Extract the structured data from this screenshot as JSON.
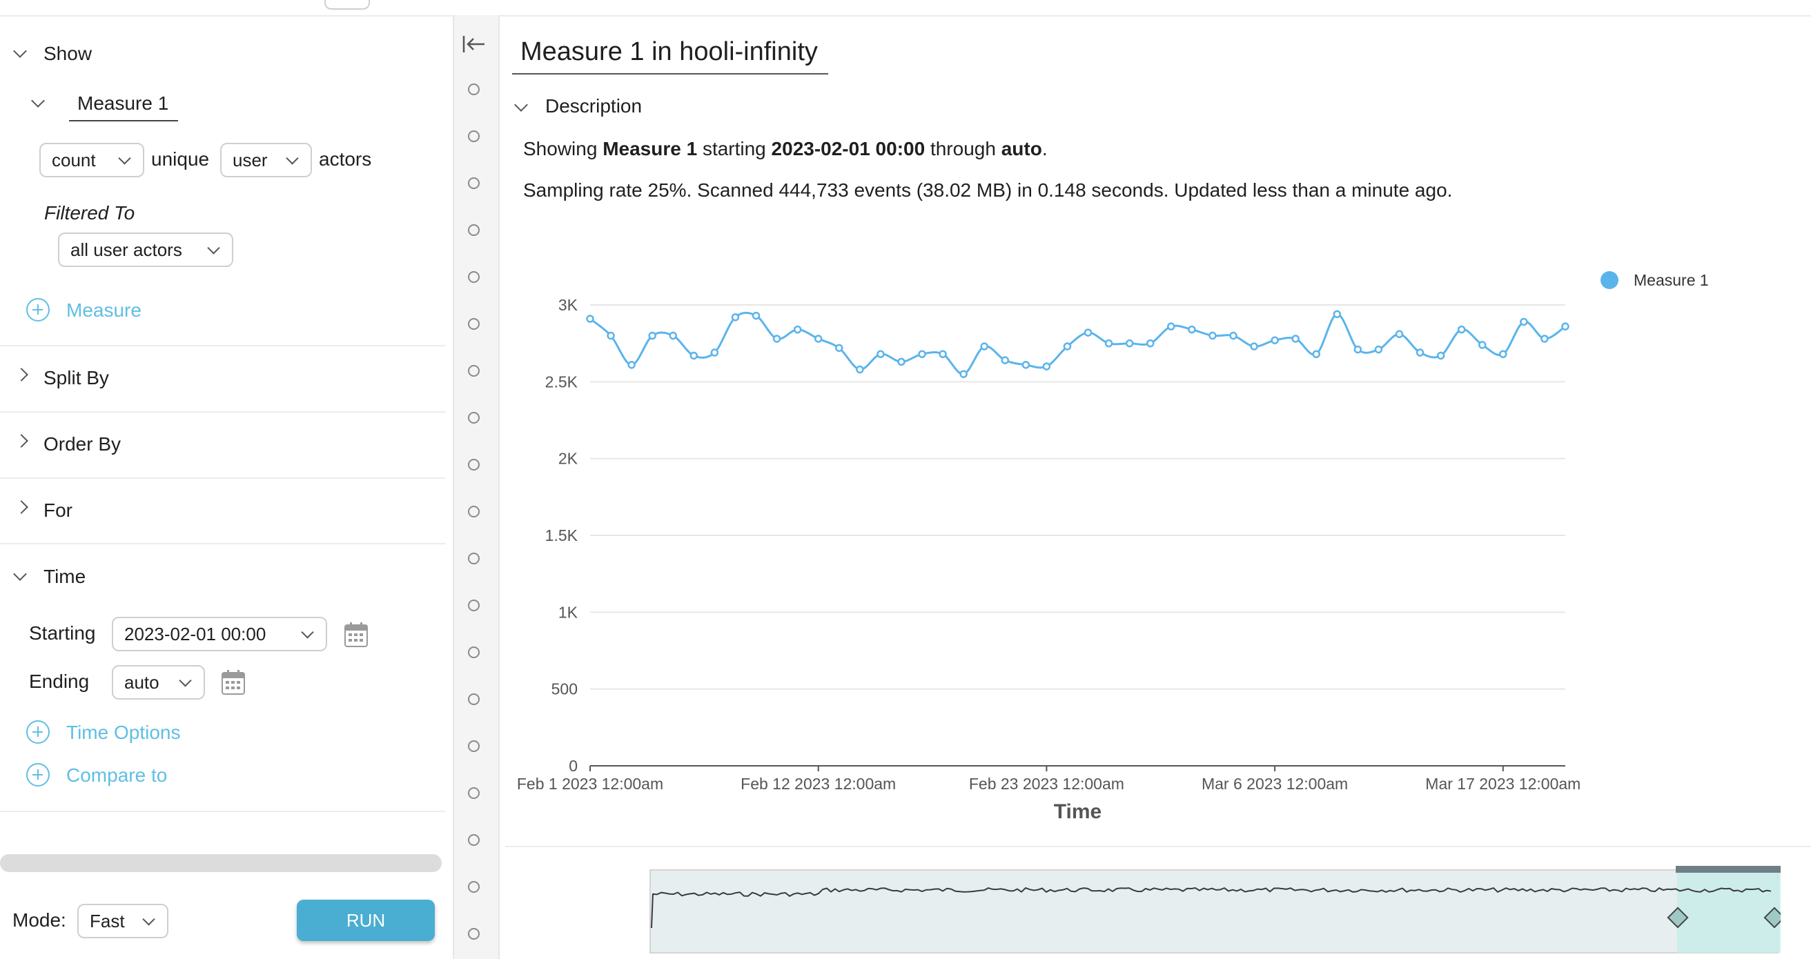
{
  "sidebar": {
    "show_label": "Show",
    "measure_tab": "Measure 1",
    "agg_select": "count",
    "unique_text": "unique",
    "entity_select": "user",
    "actors_text": "actors",
    "filtered_to_label": "Filtered To",
    "filter_select": "all user actors",
    "add_measure_label": "Measure",
    "split_by_label": "Split By",
    "order_by_label": "Order By",
    "for_label": "For",
    "time_label": "Time",
    "starting_label": "Starting",
    "starting_value": "2023-02-01 00:00",
    "ending_label": "Ending",
    "ending_value": "auto",
    "time_options_label": "Time Options",
    "compare_to_label": "Compare to",
    "mode_label": "Mode:",
    "mode_value": "Fast",
    "run_label": "RUN"
  },
  "main": {
    "title": "Measure 1 in hooli-infinity",
    "description_label": "Description",
    "summary": {
      "showing": "Showing",
      "measure": "Measure 1",
      "starting": "starting",
      "start_value": "2023-02-01 00:00",
      "through": "through",
      "end_value": "auto",
      "period": "."
    },
    "stats_line": "Sampling rate 25%. Scanned 444,733 events (38.02 MB) in 0.148 seconds. Updated less than a minute ago."
  },
  "colors": {
    "series": "#5ab4ec",
    "accent": "#5fbfe3",
    "run_button": "#49aed2",
    "brush": "#c8ece9",
    "overview_fill": "#e6eef0"
  },
  "chart_data": {
    "type": "line",
    "title": "",
    "xlabel": "Time",
    "ylabel": "",
    "legend_position": "top-right",
    "grid": true,
    "ylim": [
      0,
      3000
    ],
    "y_ticks": [
      "0",
      "500",
      "1K",
      "1.5K",
      "2K",
      "2.5K",
      "3K"
    ],
    "x_ticks": [
      "Feb 1 2023 12:00am",
      "Feb 12 2023 12:00am",
      "Feb 23 2023 12:00am",
      "Mar 6 2023 12:00am",
      "Mar 17 2023 12:00am"
    ],
    "x_start": "2023-02-01",
    "series": [
      {
        "name": "Measure 1",
        "x": [
          "2023-02-01",
          "2023-02-02",
          "2023-02-03",
          "2023-02-04",
          "2023-02-05",
          "2023-02-06",
          "2023-02-07",
          "2023-02-08",
          "2023-02-09",
          "2023-02-10",
          "2023-02-11",
          "2023-02-12",
          "2023-02-13",
          "2023-02-14",
          "2023-02-15",
          "2023-02-16",
          "2023-02-17",
          "2023-02-18",
          "2023-02-19",
          "2023-02-20",
          "2023-02-21",
          "2023-02-22",
          "2023-02-23",
          "2023-02-24",
          "2023-02-25",
          "2023-02-26",
          "2023-02-27",
          "2023-02-28",
          "2023-03-01",
          "2023-03-02",
          "2023-03-03",
          "2023-03-04",
          "2023-03-05",
          "2023-03-06",
          "2023-03-07",
          "2023-03-08",
          "2023-03-09",
          "2023-03-10",
          "2023-03-11",
          "2023-03-12",
          "2023-03-13",
          "2023-03-14",
          "2023-03-15",
          "2023-03-16",
          "2023-03-17",
          "2023-03-18",
          "2023-03-19",
          "2023-03-20"
        ],
        "values": [
          2910,
          2800,
          2610,
          2800,
          2800,
          2670,
          2690,
          2920,
          2930,
          2780,
          2840,
          2780,
          2720,
          2580,
          2680,
          2630,
          2680,
          2680,
          2550,
          2730,
          2640,
          2610,
          2600,
          2730,
          2820,
          2750,
          2750,
          2750,
          2860,
          2840,
          2800,
          2800,
          2730,
          2770,
          2780,
          2680,
          2940,
          2710,
          2710,
          2810,
          2690,
          2670,
          2840,
          2740,
          2680,
          2890,
          2780,
          2860
        ]
      }
    ]
  }
}
